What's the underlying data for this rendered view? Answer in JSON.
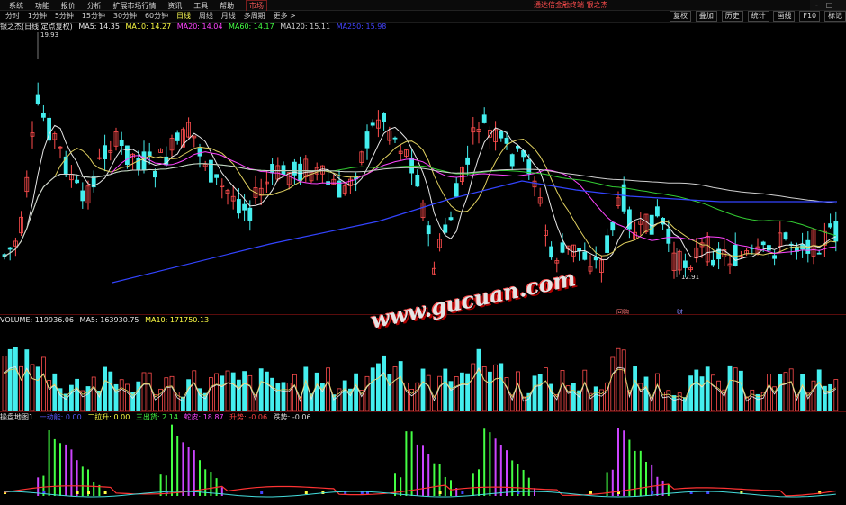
{
  "menu": {
    "items": [
      "系统",
      "功能",
      "报价",
      "分析",
      "扩展市场行情",
      "资讯",
      "工具",
      "帮助"
    ],
    "active": "市场",
    "promo": "通达信金融终端 银之杰",
    "window_buttons": [
      "-",
      "□",
      "×"
    ]
  },
  "toolbar": {
    "periods": [
      "分时",
      "1分钟",
      "5分钟",
      "15分钟",
      "30分钟",
      "60分钟",
      "日线",
      "周线",
      "月线",
      "多周期",
      "更多 >"
    ],
    "active_index": 6,
    "right_buttons": [
      "复权",
      "叠加",
      "历史",
      "统计",
      "画线",
      "F10",
      "标记"
    ]
  },
  "price_panel": {
    "title": "银之杰(日线 定点复权)",
    "ma": [
      {
        "label": "MA5: 14.35",
        "color": "#e8e8e8"
      },
      {
        "label": "MA10: 14.27",
        "color": "#ffff44"
      },
      {
        "label": "MA20: 14.04",
        "color": "#ff44ff"
      },
      {
        "label": "MA60: 14.17",
        "color": "#44ff44"
      },
      {
        "label": "MA120: 15.11",
        "color": "#cfcfcf"
      },
      {
        "label": "MA250: 15.98",
        "color": "#4444ff"
      }
    ],
    "high_label": "19.93",
    "low_label": "12.91",
    "markers": [
      "回购",
      "财"
    ]
  },
  "volume_panel": {
    "title": "VOLUME: 119936.06",
    "ma5": "MA5: 163930.75",
    "ma10": "MA10: 171750.13"
  },
  "indicator_panel": {
    "title": "操盘地图1",
    "items": [
      {
        "label": "一动能: 0.00",
        "color": "#5a5aff"
      },
      {
        "label": "二拉升: 0.00",
        "color": "#ffff44"
      },
      {
        "label": "三出货: 2.14",
        "color": "#44ff44"
      },
      {
        "label": "蛇皮: 18.87",
        "color": "#ff44ff"
      },
      {
        "label": "升势: -0.06",
        "color": "#ff4444"
      },
      {
        "label": "跌势: -0.06",
        "color": "#dddddd"
      }
    ]
  },
  "watermark": "www.gucuan.com",
  "colors": {
    "up": "#ff4d4d",
    "down": "#44eeee",
    "ma5": "#e8e8e8",
    "ma10": "#e0d060",
    "ma20": "#ff44ff",
    "ma60": "#33cc33",
    "ma120": "#cfcfcf",
    "ma250": "#3344ff"
  }
}
